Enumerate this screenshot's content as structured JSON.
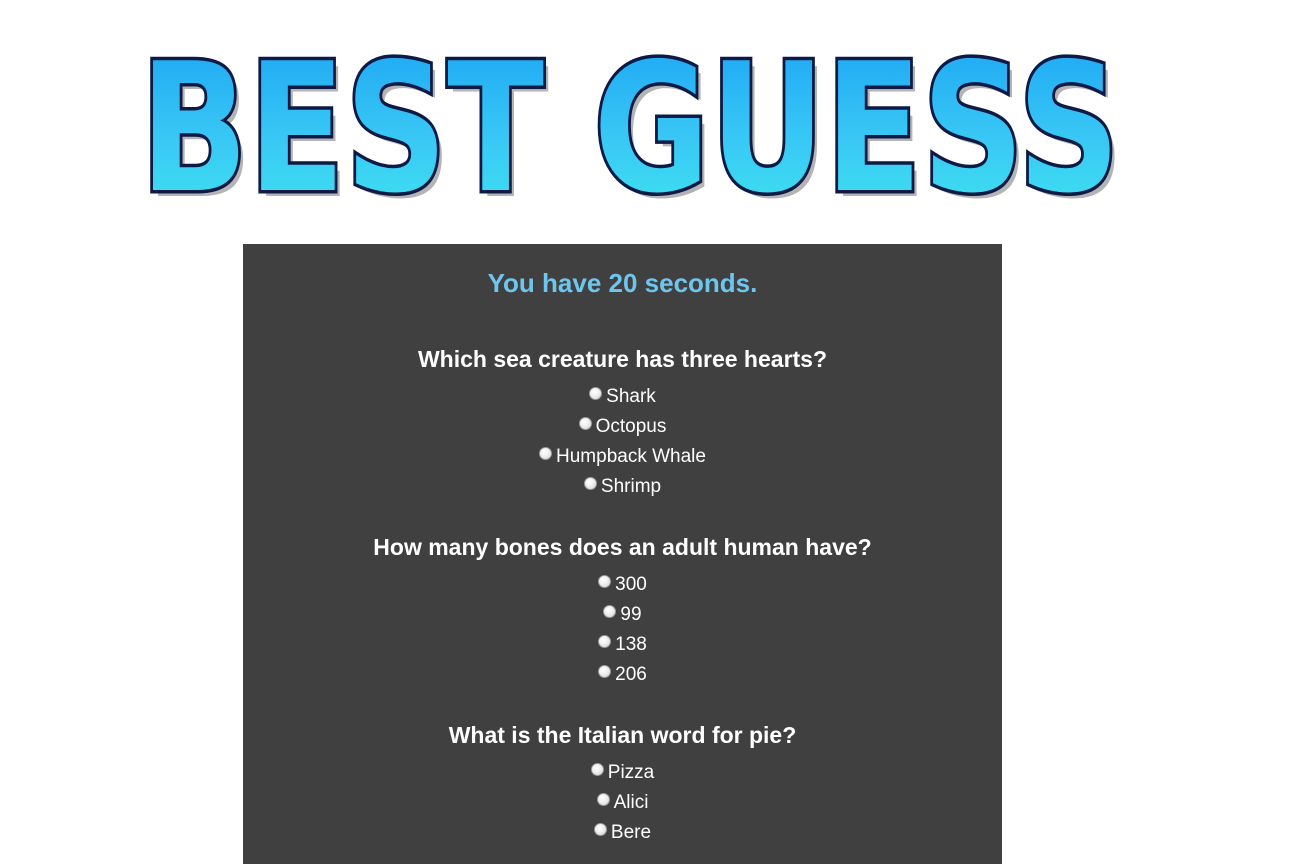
{
  "logo": {
    "text": "BEST GUESS"
  },
  "timer": {
    "text": "You have 20 seconds."
  },
  "colors": {
    "panel_background": "#404040",
    "timer_text": "#6ec6ee",
    "logo_fill": "#2fb8f0",
    "logo_outline": "#0c1a45"
  },
  "questions": [
    {
      "text": "Which sea creature has three hearts?",
      "options": [
        "Shark",
        "Octopus",
        "Humpback Whale",
        "Shrimp"
      ]
    },
    {
      "text": "How many bones does an adult human have?",
      "options": [
        "300",
        "99",
        "138",
        "206"
      ]
    },
    {
      "text": "What is the Italian word for pie?",
      "options": [
        "Pizza",
        "Alici",
        "Bere"
      ]
    }
  ]
}
